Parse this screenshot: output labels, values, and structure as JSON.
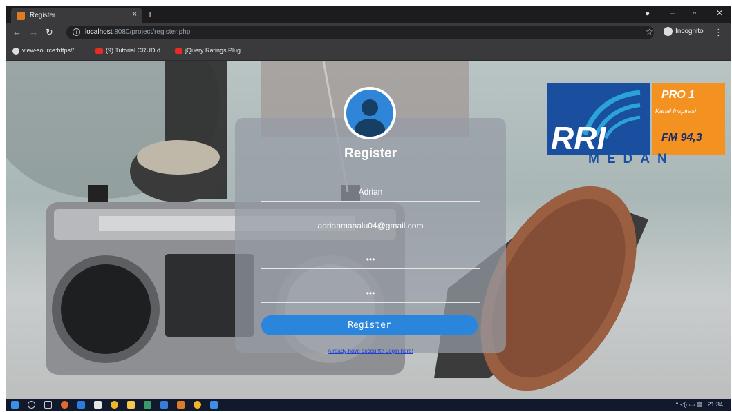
{
  "browser": {
    "tab_title": "Register",
    "tab_close": "×",
    "new_tab": "+",
    "url_host": "localhost",
    "url_rest": ":8080/project/register.php",
    "incognito_label": "Incognito",
    "bookmarks": [
      {
        "label": "view-source:https//...",
        "icon": "globe-icon"
      },
      {
        "label": "(9) Tutorial CRUD d...",
        "icon": "youtube-icon"
      },
      {
        "label": "jQuery Ratings Plug...",
        "icon": "youtube-icon"
      }
    ]
  },
  "logo": {
    "brand": "RRI",
    "pro": "PRO 1",
    "tagline": "Kanal Inspirasi",
    "frequency": "FM 94,3",
    "city": "MEDAN",
    "colors": {
      "blue": "#1a4fa0",
      "orange": "#f39221",
      "swirl": "#2ba3d8"
    }
  },
  "form": {
    "title": "Register",
    "name_value": "Adrian",
    "email_value": "adrianmanalu04@gmail.com",
    "password_value": "•••",
    "confirm_value": "•••",
    "submit_label": "Register",
    "login_link": "Already have account? Login here!",
    "accent_color": "#2a86dc"
  },
  "taskbar": {
    "time": "21:34"
  }
}
